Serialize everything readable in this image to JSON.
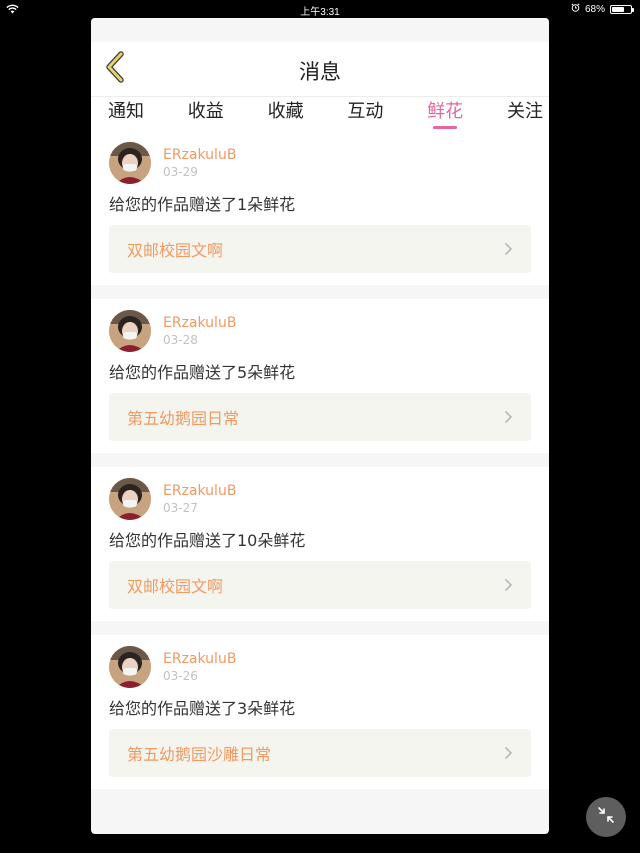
{
  "status_bar": {
    "time": "上午3:31",
    "battery_percent": "68%",
    "battery_level": 0.68
  },
  "header": {
    "title": "消息",
    "back_icon": "chevron-left-icon"
  },
  "tabs": [
    {
      "label": "通知",
      "active": false
    },
    {
      "label": "收益",
      "active": false
    },
    {
      "label": "收藏",
      "active": false
    },
    {
      "label": "互动",
      "active": false
    },
    {
      "label": "鲜花",
      "active": true
    },
    {
      "label": "关注",
      "active": false
    }
  ],
  "messages": [
    {
      "username": "ERzakuluB",
      "date": "03-29",
      "text": "给您的作品赠送了1朵鲜花",
      "work": "双邮校园文啊"
    },
    {
      "username": "ERzakuluB",
      "date": "03-28",
      "text": "给您的作品赠送了5朵鲜花",
      "work": "第五幼鹅园日常"
    },
    {
      "username": "ERzakuluB",
      "date": "03-27",
      "text": "给您的作品赠送了10朵鲜花",
      "work": "双邮校园文啊"
    },
    {
      "username": "ERzakuluB",
      "date": "03-26",
      "text": "给您的作品赠送了3朵鲜花",
      "work": "第五幼鹅园沙雕日常"
    }
  ],
  "colors": {
    "accent_pink": "#e765a0",
    "accent_orange": "#ef9a63",
    "back_arrow": "#b8a13a"
  }
}
